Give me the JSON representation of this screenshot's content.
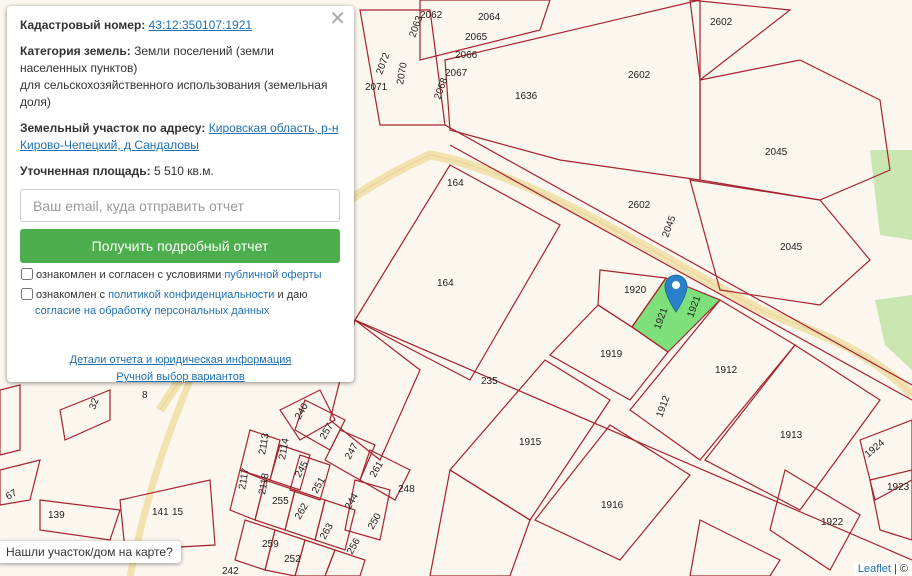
{
  "popup": {
    "cadastral_label": "Кадастровый номер:",
    "cadastral_number": "43:12:350107:1921",
    "category_label": "Категория земель:",
    "category_value_1": "Земли поселений (земли",
    "category_value_2": "населенных пунктов)",
    "category_value_3": "для сельскохозяйственного использования (земельная",
    "category_value_4": "доля)",
    "address_label": "Земельный участок по адресу:",
    "address_value_1": "Кировская область, р-н",
    "address_value_2": "Кирово-Чепецкий, д Сандаловы",
    "area_label": "Уточненная площадь:",
    "area_value": "5 510 кв.м.",
    "email_placeholder": "Ваш email, куда отправить отчет",
    "submit_label": "Получить подробный отчет",
    "consent1_text": "ознакомлен и согласен с условиями",
    "consent1_link": "публичной оферты",
    "consent2_text": "ознакомлен с",
    "consent2_link": "политикой конфиденциальности",
    "consent2_and": "и даю",
    "consent2_link2": "согласие на обработку персональных данных",
    "details_link": "Детали отчета и юридическая информация",
    "manual_link": "Ручной выбор вариантов",
    "close_symbol": "✕"
  },
  "tooltip": "Нашли участок/дом на карте?",
  "attribution": {
    "leaflet": "Leaflet",
    "sep": " | ©"
  },
  "colors": {
    "parcel_stroke": "#a4232f",
    "selected_fill": "#7de07a",
    "road": "#f2e2b0",
    "green_area": "#c9e6b0",
    "marker": "#2a81cb",
    "button": "#4cae4c"
  },
  "map": {
    "marker_icon": "map-marker-icon",
    "parcel_labels": [
      "2062",
      "2064",
      "2063",
      "2065",
      "2066",
      "2067",
      "2068",
      "2072",
      "2070",
      "2071",
      "1636",
      "2602",
      "2602",
      "2602",
      "2045",
      "2045",
      "2045",
      "164",
      "164",
      "1920",
      "1921",
      "1921",
      "1919",
      "1912",
      "1912",
      "1913",
      "1915",
      "1916",
      "1922",
      "1923",
      "1924",
      "235",
      "240",
      "257",
      "2113",
      "2114",
      "245",
      "247",
      "261",
      "248",
      "2117",
      "2118",
      "255",
      "251",
      "262",
      "244",
      "250",
      "259",
      "263",
      "256",
      "252",
      "242",
      "141",
      "15",
      "139",
      "67",
      "32",
      "8"
    ]
  }
}
